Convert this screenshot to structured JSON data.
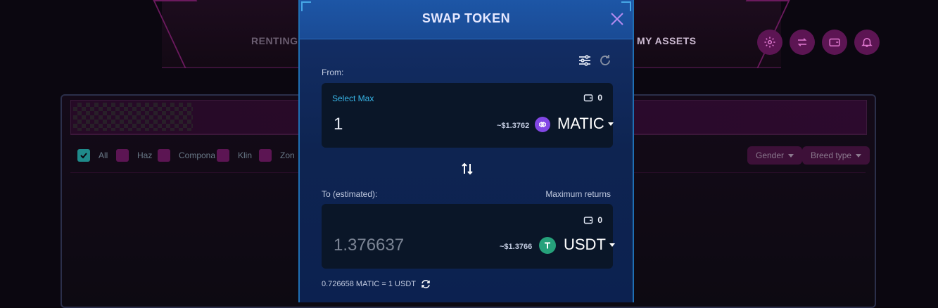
{
  "background": {
    "nav": {
      "renting": "RENTING",
      "my_assets": "MY ASSETS"
    },
    "header_icons": [
      "gear-icon",
      "swap-icon",
      "wallet-icon",
      "bell-icon"
    ],
    "filters": [
      {
        "label": "All",
        "checked": true
      },
      {
        "label": "Haz",
        "checked": false
      },
      {
        "label": "Compona",
        "checked": false
      },
      {
        "label": "Klin",
        "checked": false
      },
      {
        "label": "Zon",
        "checked": false
      }
    ],
    "dropdowns": {
      "gender": "Gender",
      "breed_type": "Breed type"
    }
  },
  "modal": {
    "title": "SWAP TOKEN",
    "from_label": "From:",
    "from": {
      "select_max": "Select Max",
      "balance": "0",
      "amount": "1",
      "usd_value": "~$1.3762",
      "token": "MATIC",
      "token_icon": "polygon-icon"
    },
    "to_label": "To (estimated):",
    "max_returns_label": "Maximum returns",
    "to": {
      "balance": "0",
      "amount": "1.376637",
      "usd_value": "~$1.3766",
      "token": "USDT",
      "token_icon": "tether-icon"
    },
    "rate": "0.726658 MATIC = 1 USDT"
  },
  "colors": {
    "accent": "#38b6e8",
    "matic": "#8247e5",
    "usdt": "#26a17b",
    "magenta": "#5c1553"
  }
}
